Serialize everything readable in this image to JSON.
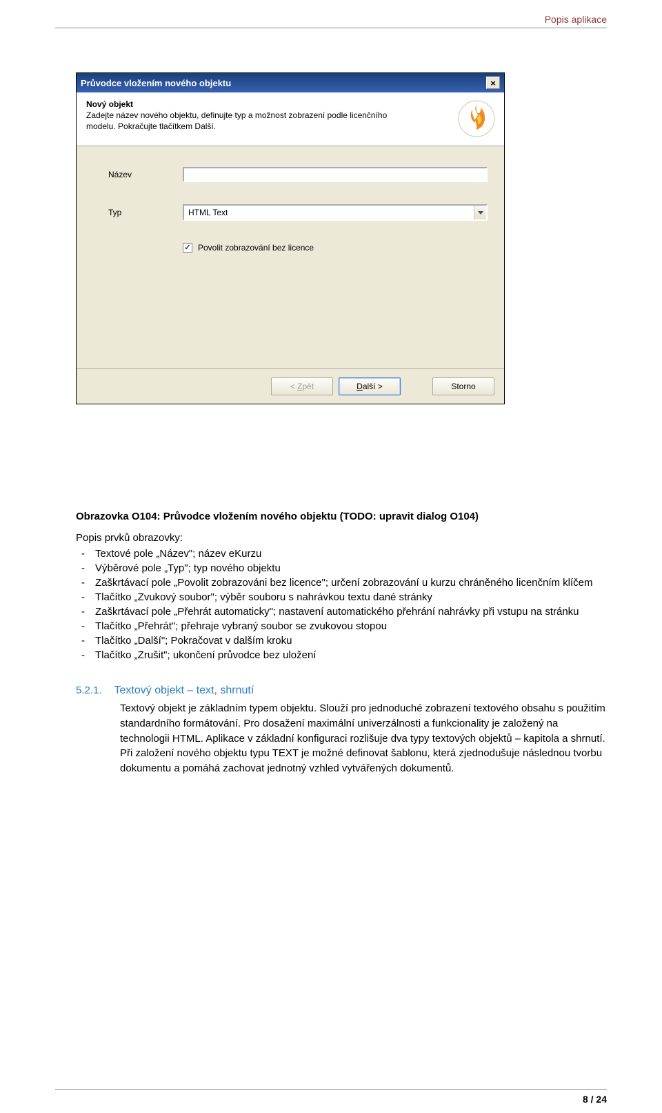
{
  "header_right": "Popis aplikace",
  "dialog": {
    "title": "Průvodce vložením nového objektu",
    "header_title": "Nový objekt",
    "header_desc": "Zadejte název nového objektu, definujte typ a možnost zobrazení podle licenčního modelu. Pokračujte tlačítkem Další.",
    "name_label": "Název",
    "name_value": "",
    "type_label": "Typ",
    "type_value": "HTML Text",
    "checkbox_label": "Povolit zobrazování bez licence",
    "btn_back": "< Zpět",
    "btn_next": "Další >",
    "btn_cancel": "Storno"
  },
  "figure_caption": "Obrazovka O104: Průvodce vložením nového objektu (TODO: upravit dialog O104)",
  "list_intro": "Popis prvků obrazovky:",
  "list_items": [
    "Textové pole „Název\"; název eKurzu",
    "Výběrové pole „Typ\"; typ nového objektu",
    "Zaškrtávací pole „Povolit zobrazováni bez licence\"; určení zobrazování u kurzu chráněného licenčním klíčem",
    "Tlačítko „Zvukový soubor\"; výběr souboru s  nahrávkou textu dané stránky",
    "Zaškrtávací pole „Přehrát automaticky\"; nastavení automatického přehrání nahrávky při vstupu na stránku",
    "Tlačítko „Přehrát\"; přehraje vybraný soubor se zvukovou stopou",
    "Tlačítko „Další\"; Pokračovat v dalším kroku",
    "Tlačítko „Zrušit\"; ukončení průvodce bez uložení"
  ],
  "section": {
    "number": "5.2.1.",
    "title": "Textový objekt – text, shrnutí",
    "body": "Textový objekt je základním typem objektu. Slouží pro jednoduché zobrazení textového obsahu s použitím standardního formátování. Pro dosažení maximální univerzálnosti a funkcionality je založený na technologii HTML. Aplikace v základní konfiguraci rozlišuje dva typy textových objektů – kapitola a shrnutí.\nPři založení nového objektu typu TEXT je možné definovat šablonu, která zjednodušuje následnou tvorbu dokumentu a pomáhá zachovat jednotný vzhled vytvářených dokumentů."
  },
  "page_number": "8 / 24"
}
